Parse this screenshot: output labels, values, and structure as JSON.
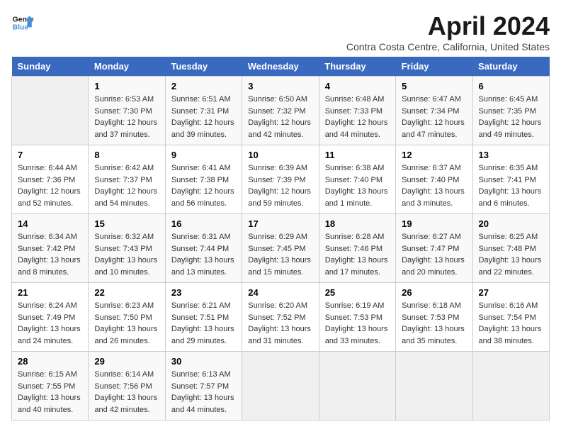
{
  "header": {
    "logo_line1": "General",
    "logo_line2": "Blue",
    "title": "April 2024",
    "subtitle": "Contra Costa Centre, California, United States"
  },
  "weekdays": [
    "Sunday",
    "Monday",
    "Tuesday",
    "Wednesday",
    "Thursday",
    "Friday",
    "Saturday"
  ],
  "weeks": [
    [
      {
        "day": "",
        "sunrise": "",
        "sunset": "",
        "daylight": ""
      },
      {
        "day": "1",
        "sunrise": "Sunrise: 6:53 AM",
        "sunset": "Sunset: 7:30 PM",
        "daylight": "Daylight: 12 hours and 37 minutes."
      },
      {
        "day": "2",
        "sunrise": "Sunrise: 6:51 AM",
        "sunset": "Sunset: 7:31 PM",
        "daylight": "Daylight: 12 hours and 39 minutes."
      },
      {
        "day": "3",
        "sunrise": "Sunrise: 6:50 AM",
        "sunset": "Sunset: 7:32 PM",
        "daylight": "Daylight: 12 hours and 42 minutes."
      },
      {
        "day": "4",
        "sunrise": "Sunrise: 6:48 AM",
        "sunset": "Sunset: 7:33 PM",
        "daylight": "Daylight: 12 hours and 44 minutes."
      },
      {
        "day": "5",
        "sunrise": "Sunrise: 6:47 AM",
        "sunset": "Sunset: 7:34 PM",
        "daylight": "Daylight: 12 hours and 47 minutes."
      },
      {
        "day": "6",
        "sunrise": "Sunrise: 6:45 AM",
        "sunset": "Sunset: 7:35 PM",
        "daylight": "Daylight: 12 hours and 49 minutes."
      }
    ],
    [
      {
        "day": "7",
        "sunrise": "Sunrise: 6:44 AM",
        "sunset": "Sunset: 7:36 PM",
        "daylight": "Daylight: 12 hours and 52 minutes."
      },
      {
        "day": "8",
        "sunrise": "Sunrise: 6:42 AM",
        "sunset": "Sunset: 7:37 PM",
        "daylight": "Daylight: 12 hours and 54 minutes."
      },
      {
        "day": "9",
        "sunrise": "Sunrise: 6:41 AM",
        "sunset": "Sunset: 7:38 PM",
        "daylight": "Daylight: 12 hours and 56 minutes."
      },
      {
        "day": "10",
        "sunrise": "Sunrise: 6:39 AM",
        "sunset": "Sunset: 7:39 PM",
        "daylight": "Daylight: 12 hours and 59 minutes."
      },
      {
        "day": "11",
        "sunrise": "Sunrise: 6:38 AM",
        "sunset": "Sunset: 7:40 PM",
        "daylight": "Daylight: 13 hours and 1 minute."
      },
      {
        "day": "12",
        "sunrise": "Sunrise: 6:37 AM",
        "sunset": "Sunset: 7:40 PM",
        "daylight": "Daylight: 13 hours and 3 minutes."
      },
      {
        "day": "13",
        "sunrise": "Sunrise: 6:35 AM",
        "sunset": "Sunset: 7:41 PM",
        "daylight": "Daylight: 13 hours and 6 minutes."
      }
    ],
    [
      {
        "day": "14",
        "sunrise": "Sunrise: 6:34 AM",
        "sunset": "Sunset: 7:42 PM",
        "daylight": "Daylight: 13 hours and 8 minutes."
      },
      {
        "day": "15",
        "sunrise": "Sunrise: 6:32 AM",
        "sunset": "Sunset: 7:43 PM",
        "daylight": "Daylight: 13 hours and 10 minutes."
      },
      {
        "day": "16",
        "sunrise": "Sunrise: 6:31 AM",
        "sunset": "Sunset: 7:44 PM",
        "daylight": "Daylight: 13 hours and 13 minutes."
      },
      {
        "day": "17",
        "sunrise": "Sunrise: 6:29 AM",
        "sunset": "Sunset: 7:45 PM",
        "daylight": "Daylight: 13 hours and 15 minutes."
      },
      {
        "day": "18",
        "sunrise": "Sunrise: 6:28 AM",
        "sunset": "Sunset: 7:46 PM",
        "daylight": "Daylight: 13 hours and 17 minutes."
      },
      {
        "day": "19",
        "sunrise": "Sunrise: 6:27 AM",
        "sunset": "Sunset: 7:47 PM",
        "daylight": "Daylight: 13 hours and 20 minutes."
      },
      {
        "day": "20",
        "sunrise": "Sunrise: 6:25 AM",
        "sunset": "Sunset: 7:48 PM",
        "daylight": "Daylight: 13 hours and 22 minutes."
      }
    ],
    [
      {
        "day": "21",
        "sunrise": "Sunrise: 6:24 AM",
        "sunset": "Sunset: 7:49 PM",
        "daylight": "Daylight: 13 hours and 24 minutes."
      },
      {
        "day": "22",
        "sunrise": "Sunrise: 6:23 AM",
        "sunset": "Sunset: 7:50 PM",
        "daylight": "Daylight: 13 hours and 26 minutes."
      },
      {
        "day": "23",
        "sunrise": "Sunrise: 6:21 AM",
        "sunset": "Sunset: 7:51 PM",
        "daylight": "Daylight: 13 hours and 29 minutes."
      },
      {
        "day": "24",
        "sunrise": "Sunrise: 6:20 AM",
        "sunset": "Sunset: 7:52 PM",
        "daylight": "Daylight: 13 hours and 31 minutes."
      },
      {
        "day": "25",
        "sunrise": "Sunrise: 6:19 AM",
        "sunset": "Sunset: 7:53 PM",
        "daylight": "Daylight: 13 hours and 33 minutes."
      },
      {
        "day": "26",
        "sunrise": "Sunrise: 6:18 AM",
        "sunset": "Sunset: 7:53 PM",
        "daylight": "Daylight: 13 hours and 35 minutes."
      },
      {
        "day": "27",
        "sunrise": "Sunrise: 6:16 AM",
        "sunset": "Sunset: 7:54 PM",
        "daylight": "Daylight: 13 hours and 38 minutes."
      }
    ],
    [
      {
        "day": "28",
        "sunrise": "Sunrise: 6:15 AM",
        "sunset": "Sunset: 7:55 PM",
        "daylight": "Daylight: 13 hours and 40 minutes."
      },
      {
        "day": "29",
        "sunrise": "Sunrise: 6:14 AM",
        "sunset": "Sunset: 7:56 PM",
        "daylight": "Daylight: 13 hours and 42 minutes."
      },
      {
        "day": "30",
        "sunrise": "Sunrise: 6:13 AM",
        "sunset": "Sunset: 7:57 PM",
        "daylight": "Daylight: 13 hours and 44 minutes."
      },
      {
        "day": "",
        "sunrise": "",
        "sunset": "",
        "daylight": ""
      },
      {
        "day": "",
        "sunrise": "",
        "sunset": "",
        "daylight": ""
      },
      {
        "day": "",
        "sunrise": "",
        "sunset": "",
        "daylight": ""
      },
      {
        "day": "",
        "sunrise": "",
        "sunset": "",
        "daylight": ""
      }
    ]
  ]
}
